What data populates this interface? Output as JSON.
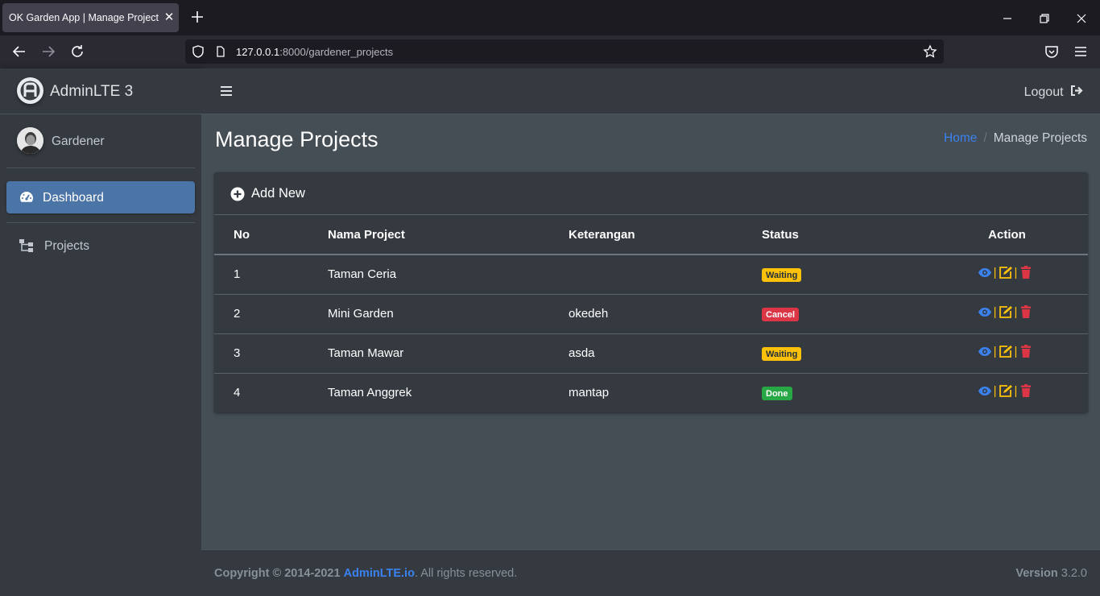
{
  "browser": {
    "tab_title": "OK Garden App | Manage Project",
    "tab_close": "✕",
    "url_host": "127.0.0.1",
    "url_rest": ":8000/gardener_projects"
  },
  "sidebar": {
    "brand": "AdminLTE 3",
    "user": "Gardener",
    "items": [
      {
        "label": "Dashboard",
        "icon": "tachometer-icon",
        "active": true
      },
      {
        "label": "Projects",
        "icon": "sitemap-icon",
        "active": false
      }
    ]
  },
  "topnav": {
    "logout": "Logout"
  },
  "page": {
    "title": "Manage Projects",
    "breadcrumb": {
      "home": "Home",
      "sep": "/",
      "current": "Manage Projects"
    }
  },
  "card": {
    "add_new": "Add New",
    "headers": {
      "no": "No",
      "name": "Nama Project",
      "ket": "Keterangan",
      "status": "Status",
      "action": "Action"
    },
    "rows": [
      {
        "no": "1",
        "name": "Taman Ceria",
        "ket": "",
        "status": "Waiting",
        "status_type": "warning"
      },
      {
        "no": "2",
        "name": "Mini Garden",
        "ket": "okedeh",
        "status": "Cancel",
        "status_type": "danger"
      },
      {
        "no": "3",
        "name": "Taman Mawar",
        "ket": "asda",
        "status": "Waiting",
        "status_type": "warning"
      },
      {
        "no": "4",
        "name": "Taman Anggrek",
        "ket": "mantap",
        "status": "Done",
        "status_type": "success"
      }
    ],
    "action_sep": "|"
  },
  "footer": {
    "copyright": "Copyright © 2014-2021",
    "link": "AdminLTE.io",
    "rights": ". All rights reserved.",
    "version_label": "Version",
    "version": "3.2.0"
  },
  "colors": {
    "sidebar": "#343a40",
    "content": "#454d55",
    "active": "#4b74a7",
    "link": "#3b82f0",
    "warning": "#ffc107",
    "danger": "#dc3545",
    "success": "#28a745"
  }
}
